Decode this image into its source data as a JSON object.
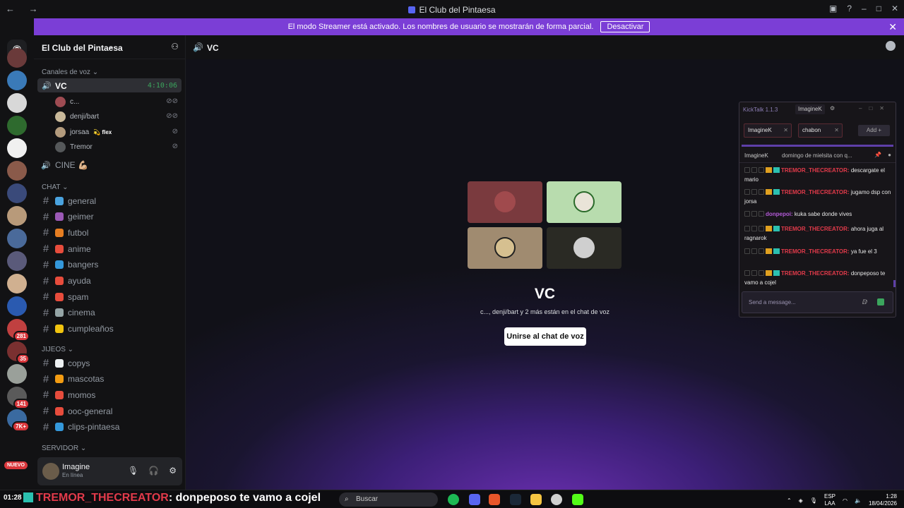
{
  "window": {
    "title": "El Club del Pintaesa",
    "nav_arrows": "← →"
  },
  "banner": {
    "text": "El modo Streamer está activado. Los nombres de usuario se mostrarán de forma parcial.",
    "button": "Desactivar"
  },
  "server_rail": {
    "badges": [
      "281",
      "35",
      "141",
      "7K+"
    ],
    "new_label": "NUEVO"
  },
  "guild": {
    "name": "El Club del Pintaesa",
    "categories": {
      "voice": "Canales de voz",
      "chat": "CHAT",
      "jijeos": "JIJEOS",
      "servidor": "SERVIDOR"
    },
    "voice_channels": [
      {
        "label": "VC",
        "timer": "4:10:06",
        "active": true
      },
      {
        "label": "CINE 💪🏼"
      }
    ],
    "voice_users": [
      {
        "name": "c...",
        "color": "#9e4b52"
      },
      {
        "name": "denji/bart",
        "color": "#c9b99a"
      },
      {
        "name": "jorsaa",
        "tag": "💫 flex",
        "color": "#b39b7d"
      },
      {
        "name": "Tremor",
        "color": "#55585a"
      }
    ],
    "chat_channels": [
      "general",
      "geimer",
      "futbol",
      "anime",
      "bangers",
      "ayuda",
      "spam",
      "cinema",
      "cumpleaños"
    ],
    "chat_emoji_colors": [
      "#4aa3df",
      "#9b59b6",
      "#e67e22",
      "#e74c3c",
      "#3498db",
      "#e74c3c",
      "#e74c3c",
      "#95a5a6",
      "#f1c40f"
    ],
    "jijeos_channels": [
      "copys",
      "mascotas",
      "momos",
      "ooc-general",
      "clips-pintaesa"
    ],
    "jijeos_emoji_colors": [
      "#ecf0f1",
      "#f39c12",
      "#e74c3c",
      "#e74c3c",
      "#3498db"
    ]
  },
  "user_panel": {
    "name": "Imagine",
    "status": "En línea"
  },
  "main": {
    "channel_title": "VC",
    "vc_title": "VC",
    "vc_subtitle": "c..., denji/bart y 2 más están en el chat de voz",
    "join_button": "Unirse al chat de voz",
    "tiles": [
      {
        "bg": "#7a3a3e",
        "avatar": "#a04a4d"
      },
      {
        "bg": "#b8dcae",
        "avatar": "#e9e4d8"
      },
      {
        "bg": "#a08b70",
        "avatar": "#d6c090"
      },
      {
        "bg": "#2a2a24",
        "avatar": "#cfcfcf"
      }
    ]
  },
  "kicktalk": {
    "title": "KickTalk 1.1.3",
    "selected_tab": "ImagineK",
    "tabs": [
      "ImagineK",
      "chabon"
    ],
    "add_button": "Add +",
    "pinned_user": "ImagineK",
    "pinned_message": "domingo de mielsita con q...",
    "messages": [
      {
        "user": "TREMOR_THECREATOR:",
        "text": "descargate el mario"
      },
      {
        "user": "TREMOR_THECREATOR:",
        "text": "jugamo dsp con jorsa"
      },
      {
        "user": "donpepoi:",
        "text": "kuka sabe donde vives"
      },
      {
        "user": "TREMOR_THECREATOR:",
        "text": "ahora juga al ragnarok"
      },
      {
        "user": "TREMOR_THECREATOR:",
        "text": "ya fue el 3"
      },
      {
        "user": "TREMOR_THECREATOR:",
        "text": "donpeposo te vamo a cojel"
      }
    ],
    "input_placeholder": "Send a message..."
  },
  "taskbar": {
    "clock": "01:28",
    "ticker_user": "TREMOR_THECREATOR",
    "ticker_text": ": donpeposo te vamo a cojel",
    "search": "Buscar",
    "lang": "ESP",
    "lang2": "LAA",
    "time": "1:28",
    "date": "18/04/2026"
  }
}
